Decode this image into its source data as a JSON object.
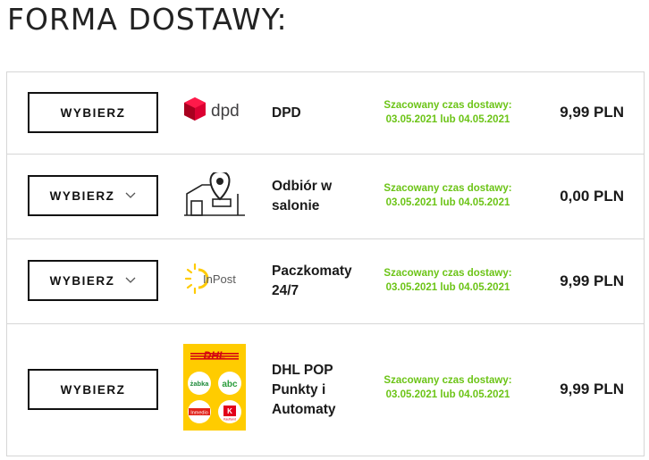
{
  "page": {
    "title": "FORMA DOSTAWY:"
  },
  "colors": {
    "eta_green": "#6cc417",
    "dpd_red": "#dc0032",
    "inpost_yellow": "#ffcb05",
    "dhl_yellow": "#ffcc00",
    "dhl_red": "#d40511"
  },
  "options": [
    {
      "button_label": "WYBIERZ",
      "has_dropdown": false,
      "logo_icon": "dpd-logo-icon",
      "logo_text": "dpd",
      "name": "DPD",
      "eta_label": "Szacowany czas dostawy:",
      "eta_dates": "03.05.2021 lub 04.05.2021",
      "price": "9,99 PLN"
    },
    {
      "button_label": "WYBIERZ",
      "has_dropdown": true,
      "logo_icon": "store-pin-icon",
      "name": "Odbiór w salonie",
      "eta_label": "Szacowany czas dostawy:",
      "eta_dates": "03.05.2021 lub 04.05.2021",
      "price": "0,00 PLN"
    },
    {
      "button_label": "WYBIERZ",
      "has_dropdown": true,
      "logo_icon": "inpost-logo-icon",
      "logo_text": "InPost",
      "name": "Paczkomaty 24/7",
      "eta_label": "Szacowany czas dostawy:",
      "eta_dates": "03.05.2021 lub 04.05.2021",
      "price": "9,99 PLN"
    },
    {
      "button_label": "WYBIERZ",
      "has_dropdown": false,
      "logo_icon": "dhl-pop-logo-icon",
      "logo_text": "DHL",
      "partner_logos": [
        "żabka",
        "abc",
        "Inmedio",
        "Kaufland"
      ],
      "name": "DHL POP Punkty i Automaty",
      "eta_label": "Szacowany czas dostawy:",
      "eta_dates": "03.05.2021 lub 04.05.2021",
      "price": "9,99 PLN"
    }
  ]
}
